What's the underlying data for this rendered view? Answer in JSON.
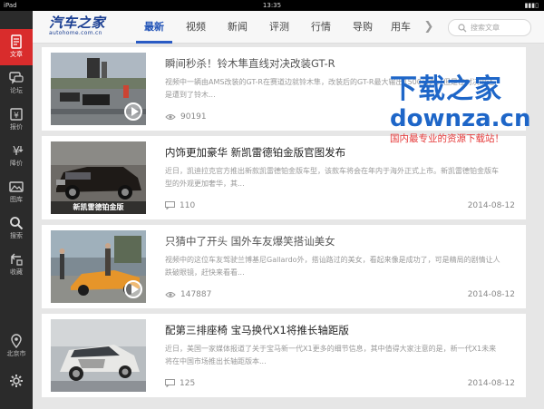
{
  "status_bar": {
    "carrier": "iPad",
    "time": "13:35",
    "battery": "■■"
  },
  "sidebar": {
    "items": [
      {
        "label": "文章",
        "icon": "document-icon",
        "active": true
      },
      {
        "label": "论坛",
        "icon": "forum-icon",
        "active": false
      },
      {
        "label": "报价",
        "icon": "price-icon",
        "active": false
      },
      {
        "label": "降价",
        "icon": "discount-icon",
        "active": false
      },
      {
        "label": "图库",
        "icon": "gallery-icon",
        "active": false
      },
      {
        "label": "搜索",
        "icon": "search-icon",
        "active": false
      },
      {
        "label": "收藏",
        "icon": "star-icon",
        "active": false
      }
    ],
    "city": "北京市",
    "settings_icon": "gear-icon"
  },
  "header": {
    "logo_text": "汽车之家",
    "logo_sub": "autohome.com.cn",
    "tabs": [
      "最新",
      "视频",
      "新闻",
      "评测",
      "行情",
      "导购",
      "用车"
    ],
    "active_tab": "最新",
    "more_icon": "chevron-right-icon",
    "search_placeholder": "搜索文章"
  },
  "articles": [
    {
      "title": "瞬间秒杀！铃木隼直线对决改装GT-R",
      "summary": "视频中一辆由AMS改装的GT-R在赛道边就铃木隼，改装后的GT-R最大输出1500马力，但是在对决中还是遭到了铃木...",
      "count": "90191",
      "count_icon": "eye-icon",
      "date": "",
      "caption": "",
      "video": true,
      "read": true
    },
    {
      "title": "内饰更加豪华 新凯雷德铂金版官图发布",
      "summary": "近日，凯迪拉克官方推出新款凯雷德铂金版车型，该款车将会在年内于海外正式上市。新凯雷德铂金版车型的外观更加奢华，其...",
      "count": "110",
      "count_icon": "comment-icon",
      "date": "2014-08-12",
      "caption": "新凯雷德铂金版",
      "video": false,
      "read": false
    },
    {
      "title": "只猜中了开头 国外车友爆笑搭讪美女",
      "summary": "视频中的这位车友驾驶兰博基尼Gallardo外，搭讪路过的美女，看起来像是成功了，可是精局的剧情让人跌破眼镜，赶快来看看...",
      "count": "147887",
      "count_icon": "eye-icon",
      "date": "2014-08-12",
      "caption": "",
      "video": true,
      "read": true
    },
    {
      "title": "配第三排座椅 宝马换代X1将推长轴距版",
      "summary": "近日，美国一家媒体报道了关于宝马新一代X1更多的细节信息，其中值得大家注意的是，新一代X1未来将在中国市场推出长轴距版本...",
      "count": "125",
      "count_icon": "comment-icon",
      "date": "2014-08-12",
      "caption": "",
      "video": false,
      "read": false
    }
  ],
  "watermark": {
    "line1": "下载之家",
    "line2": "downza.cn",
    "line3": "国内最专业的资源下载站！"
  },
  "colors": {
    "accent": "#d92c2c",
    "tab_active": "#2052b7",
    "watermark_blue": "#1e66c8",
    "watermark_red": "#e53838"
  }
}
